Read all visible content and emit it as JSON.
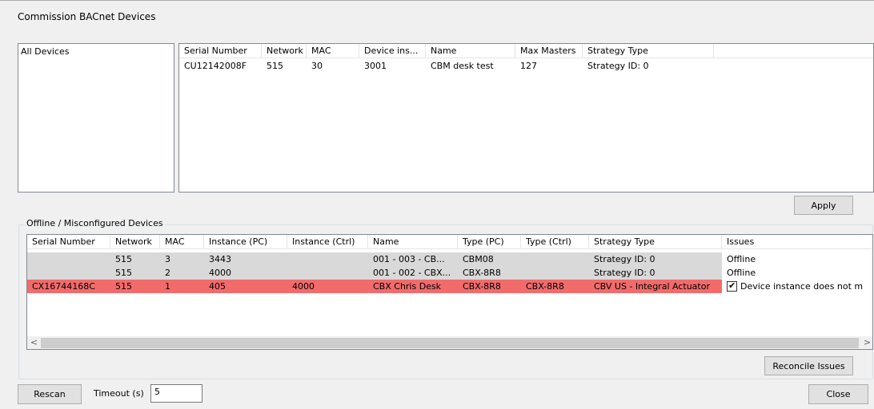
{
  "window": {
    "title": "Commission BACnet Devices"
  },
  "tree": {
    "root_label": "All Devices"
  },
  "top_table": {
    "columns": [
      "Serial Number",
      "Network",
      "MAC",
      "Device ins...",
      "Name",
      "Max Masters",
      "Strategy Type"
    ],
    "rows": [
      [
        "CU12142008F",
        "515",
        "30",
        "3001",
        "CBM desk test",
        "127",
        "Strategy ID: 0"
      ]
    ]
  },
  "apply_button": "Apply",
  "offline_group": {
    "label": "Offline / Misconfigured Devices",
    "columns": [
      "Serial Number",
      "Network",
      "MAC",
      "Instance (PC)",
      "Instance (Ctrl)",
      "Name",
      "Type (PC)",
      "Type (Ctrl)",
      "Strategy Type",
      "Issues"
    ],
    "rows": [
      {
        "cells": [
          "",
          "515",
          "3",
          "3443",
          "",
          "001 - 003 - CB...",
          "CBM08",
          "",
          "Strategy ID: 0",
          "Offline"
        ],
        "state": "gray"
      },
      {
        "cells": [
          "",
          "515",
          "2",
          "4000",
          "",
          "001 - 002 - CBX...",
          "CBX-8R8",
          "",
          "Strategy ID: 0",
          "Offline"
        ],
        "state": "gray"
      },
      {
        "cells": [
          "CX16744168C",
          "515",
          "1",
          "405",
          "4000",
          "CBX Chris Desk",
          "CBX-8R8",
          "CBX-8R8",
          "CBV US - Integral Actuator",
          "Device instance does not m"
        ],
        "state": "red",
        "issue_checked": true
      }
    ],
    "scroll_left": "<",
    "scroll_right": ">"
  },
  "reconcile_button": "Reconcile Issues",
  "rescan_button": "Rescan",
  "timeout": {
    "label": "Timeout (s)",
    "value": "5"
  },
  "close_button": "Close",
  "colors": {
    "error_row": "#f26b6b",
    "offline_row": "#d9d9d9"
  }
}
